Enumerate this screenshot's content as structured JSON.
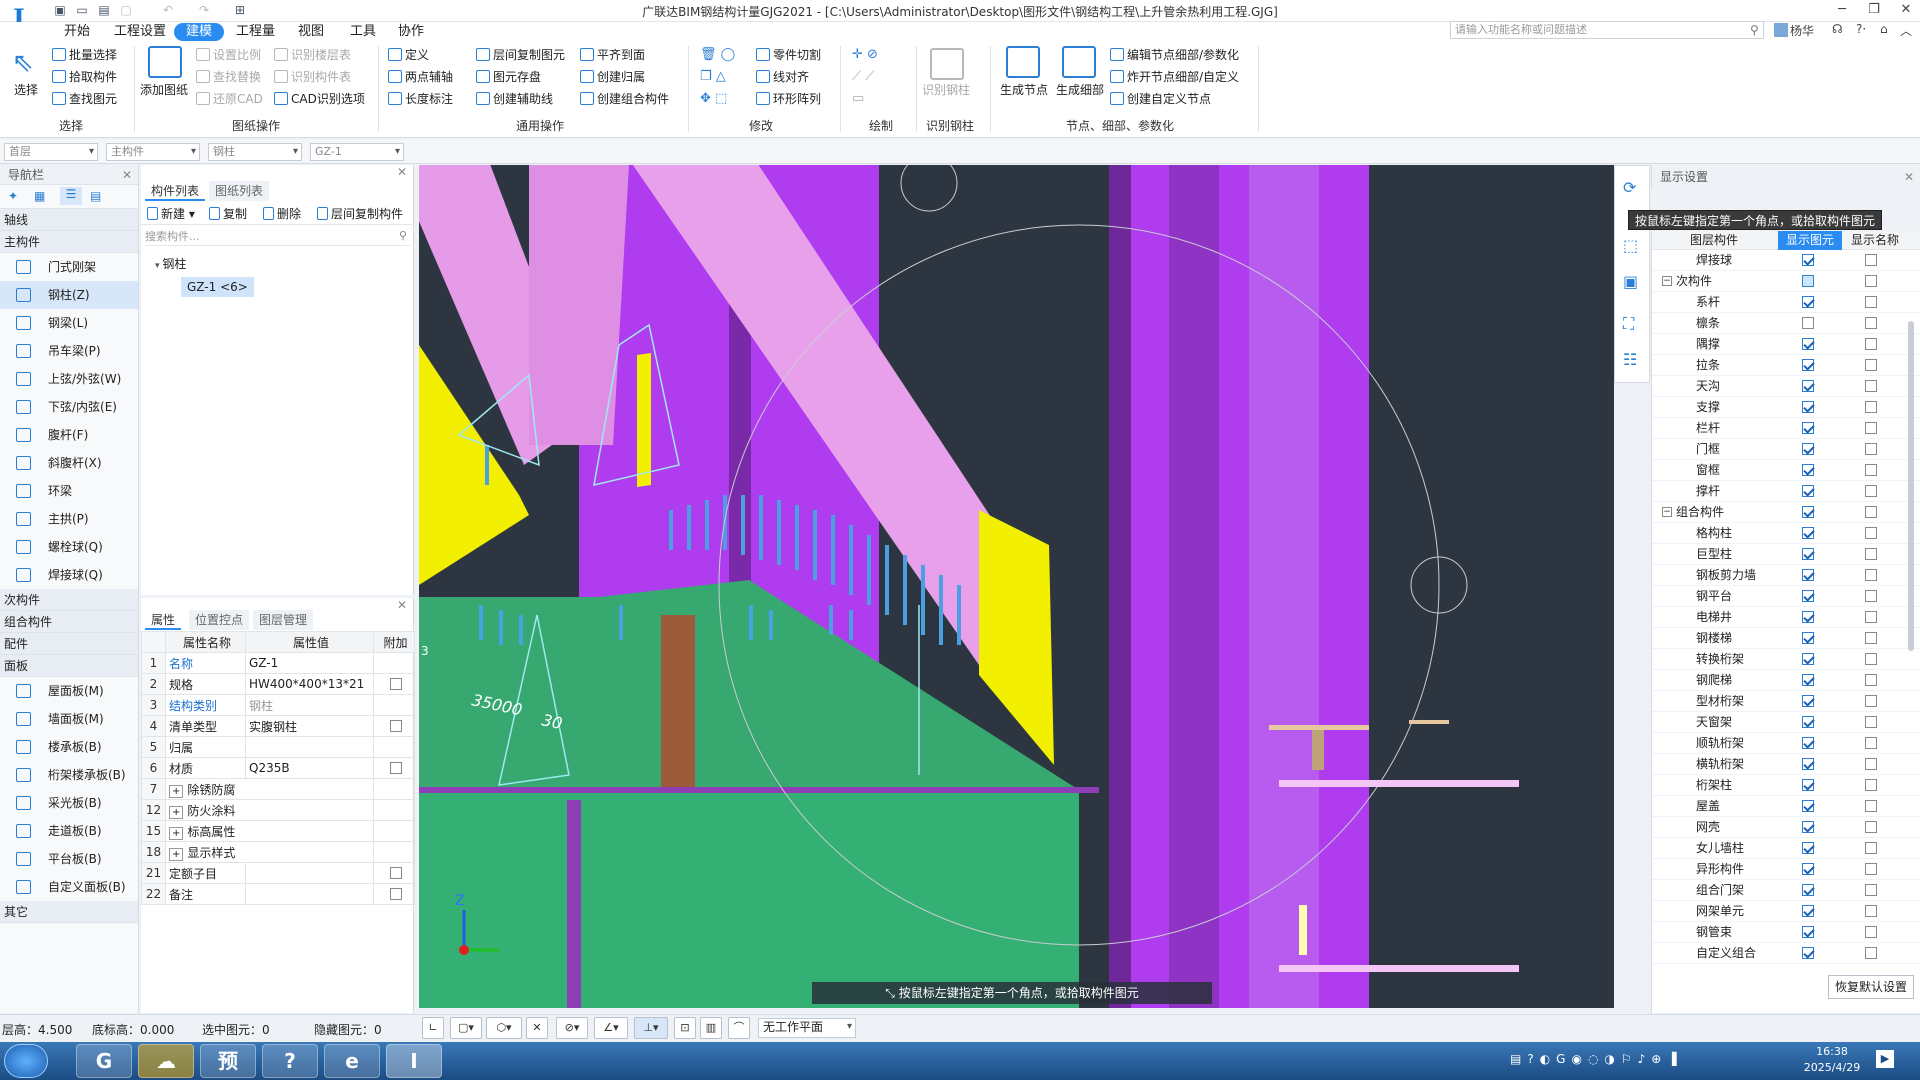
{
  "app": {
    "title": "广联达BIM钢结构计量GJG2021 - [C:\\Users\\Administrator\\Desktop\\图形文件\\钢结构工程\\上升管余热利用工程.GJG]"
  },
  "menu": [
    "开始",
    "工程设置",
    "建模",
    "工程量",
    "视图",
    "工具",
    "协作"
  ],
  "search": {
    "placeholder": "请输入功能名称或问题描述"
  },
  "user": "杨华",
  "ribbon": {
    "select": {
      "big": "选择",
      "items": [
        "批量选择",
        "拾取构件",
        "查找图元"
      ],
      "group": "选择"
    },
    "drawing": {
      "big": "添加图纸",
      "col1": [
        "设置比例",
        "查找替换",
        "还原CAD"
      ],
      "col2": [
        "识别楼层表",
        "识别构件表",
        "CAD识别选项"
      ],
      "group": "图纸操作"
    },
    "common": {
      "col1": [
        "定义",
        "两点辅轴",
        "长度标注"
      ],
      "col2": [
        "层间复制图元",
        "图元存盘",
        "创建辅助线"
      ],
      "col3": [
        "平齐到面",
        "创建归属",
        "创建组合构件"
      ],
      "group": "通用操作"
    },
    "modify": {
      "col2": [
        "零件切割",
        "线对齐",
        "环形阵列"
      ],
      "group": "修改"
    },
    "draw": {
      "group": "绘制"
    },
    "recog": {
      "big": "识别钢柱",
      "group": "识别钢柱"
    },
    "nodes": {
      "big1": "生成节点",
      "big2": "生成细部",
      "items": [
        "编辑节点细部/参数化",
        "炸开节点细部/自定义",
        "创建自定义节点"
      ],
      "group": "节点、细部、参数化"
    }
  },
  "selectors": [
    "首层",
    "主构件",
    "钢柱",
    "GZ-1"
  ],
  "nav": {
    "title": "导航栏",
    "cats": [
      "轴线",
      "主构件",
      "次构件",
      "组合构件",
      "配件",
      "面板",
      "其它"
    ],
    "main_items": [
      "门式刚架",
      "钢柱(Z)",
      "钢梁(L)",
      "吊车梁(P)",
      "上弦/外弦(W)",
      "下弦/内弦(E)",
      "腹杆(F)",
      "斜腹杆(X)",
      "环梁",
      "主拱(P)",
      "螺栓球(Q)",
      "焊接球(Q)"
    ],
    "panel_items": [
      "屋面板(M)",
      "墙面板(M)",
      "楼承板(B)",
      "桁架楼承板(B)",
      "采光板(B)",
      "走道板(B)",
      "平台板(B)",
      "自定义面板(B)"
    ]
  },
  "complist": {
    "tabs": [
      "构件列表",
      "图纸列表"
    ],
    "toolbar": [
      "新建",
      "复制",
      "删除",
      "层间复制构件"
    ],
    "search_placeholder": "搜索构件...",
    "tree_parent": "钢柱",
    "tree_child": "GZ-1 <6>"
  },
  "props": {
    "tabs": [
      "属性",
      "位置控点",
      "图层管理"
    ],
    "headers": [
      "属性名称",
      "属性值",
      "附加"
    ],
    "rows": [
      {
        "n": "1",
        "name": "名称",
        "val": "GZ-1",
        "cb": ""
      },
      {
        "n": "2",
        "name": "规格",
        "val": "HW400*400*13*21",
        "cb": "empty"
      },
      {
        "n": "3",
        "name": "结构类别",
        "val": "钢柱",
        "cb": ""
      },
      {
        "n": "4",
        "name": "清单类型",
        "val": "实腹钢柱",
        "cb": "empty"
      },
      {
        "n": "5",
        "name": "归属",
        "val": "",
        "cb": ""
      },
      {
        "n": "6",
        "name": "材质",
        "val": "Q235B",
        "cb": "empty"
      },
      {
        "n": "7",
        "name": "除锈防腐",
        "val": "",
        "cb": ""
      },
      {
        "n": "12",
        "name": "防火涂料",
        "val": "",
        "cb": ""
      },
      {
        "n": "15",
        "name": "标高属性",
        "val": "",
        "cb": ""
      },
      {
        "n": "18",
        "name": "显示样式",
        "val": "",
        "cb": ""
      },
      {
        "n": "21",
        "name": "定额子目",
        "val": "",
        "cb": "empty"
      },
      {
        "n": "22",
        "name": "备注",
        "val": "",
        "cb": "empty"
      }
    ]
  },
  "viewport": {
    "tooltip": "按鼠标左键指定第一个角点，或拾取构件图元",
    "hint": "按鼠标左键指定第一个角点，或拾取构件图元",
    "dim_text1": "35000",
    "dim_text2": "30",
    "dim_text3": "3",
    "axis_z": "Z"
  },
  "display": {
    "title": "显示设置",
    "headers": [
      "图层构件",
      "显示图元",
      "显示名称"
    ],
    "restore": "恢复默认设置",
    "rows": [
      {
        "label": "焊接球",
        "t": "item",
        "c1": true,
        "c2": false
      },
      {
        "label": "次构件",
        "t": "group",
        "c1": "part",
        "c2": false
      },
      {
        "label": "系杆",
        "t": "item",
        "c1": true,
        "c2": false
      },
      {
        "label": "檩条",
        "t": "item",
        "c1": false,
        "c2": false
      },
      {
        "label": "隅撑",
        "t": "item",
        "c1": true,
        "c2": false
      },
      {
        "label": "拉条",
        "t": "item",
        "c1": true,
        "c2": false
      },
      {
        "label": "天沟",
        "t": "item",
        "c1": true,
        "c2": false
      },
      {
        "label": "支撑",
        "t": "item",
        "c1": true,
        "c2": false
      },
      {
        "label": "栏杆",
        "t": "item",
        "c1": true,
        "c2": false
      },
      {
        "label": "门框",
        "t": "item",
        "c1": true,
        "c2": false
      },
      {
        "label": "窗框",
        "t": "item",
        "c1": true,
        "c2": false
      },
      {
        "label": "撑杆",
        "t": "item",
        "c1": true,
        "c2": false
      },
      {
        "label": "组合构件",
        "t": "group",
        "c1": true,
        "c2": false
      },
      {
        "label": "格构柱",
        "t": "item",
        "c1": true,
        "c2": false
      },
      {
        "label": "巨型柱",
        "t": "item",
        "c1": true,
        "c2": false
      },
      {
        "label": "钢板剪力墙",
        "t": "item",
        "c1": true,
        "c2": false
      },
      {
        "label": "钢平台",
        "t": "item",
        "c1": true,
        "c2": false
      },
      {
        "label": "电梯井",
        "t": "item",
        "c1": true,
        "c2": false
      },
      {
        "label": "钢楼梯",
        "t": "item",
        "c1": true,
        "c2": false
      },
      {
        "label": "转换桁架",
        "t": "item",
        "c1": true,
        "c2": false
      },
      {
        "label": "钢爬梯",
        "t": "item",
        "c1": true,
        "c2": false
      },
      {
        "label": "型材桁架",
        "t": "item",
        "c1": true,
        "c2": false
      },
      {
        "label": "天窗架",
        "t": "item",
        "c1": true,
        "c2": false
      },
      {
        "label": "顺轨桁架",
        "t": "item",
        "c1": true,
        "c2": false
      },
      {
        "label": "横轨桁架",
        "t": "item",
        "c1": true,
        "c2": false
      },
      {
        "label": "桁架柱",
        "t": "item",
        "c1": true,
        "c2": false
      },
      {
        "label": "屋盖",
        "t": "item",
        "c1": true,
        "c2": false
      },
      {
        "label": "网壳",
        "t": "item",
        "c1": true,
        "c2": false
      },
      {
        "label": "女儿墙柱",
        "t": "item",
        "c1": true,
        "c2": false
      },
      {
        "label": "异形构件",
        "t": "item",
        "c1": true,
        "c2": false
      },
      {
        "label": "组合门架",
        "t": "item",
        "c1": true,
        "c2": false
      },
      {
        "label": "网架单元",
        "t": "item",
        "c1": true,
        "c2": false
      },
      {
        "label": "钢管束",
        "t": "item",
        "c1": true,
        "c2": false
      },
      {
        "label": "自定义组合",
        "t": "item",
        "c1": true,
        "c2": false
      }
    ]
  },
  "status": {
    "floor_h": "层高：4.500",
    "base_h": "底标高：0.000",
    "selected": "选中图元：0",
    "hidden": "隐藏图元：0",
    "plane": "无工作平面"
  },
  "taskbar": {
    "time": "16:38",
    "date": "2025/4/29",
    "apps": [
      "G",
      "预",
      "?",
      "e",
      "I"
    ]
  },
  "colors": {
    "accent": "#2a8bf0",
    "magenta": "#b03cf0",
    "pink_pipe": "#e59be8",
    "green": "#36a870",
    "yellow": "#f2f000"
  }
}
